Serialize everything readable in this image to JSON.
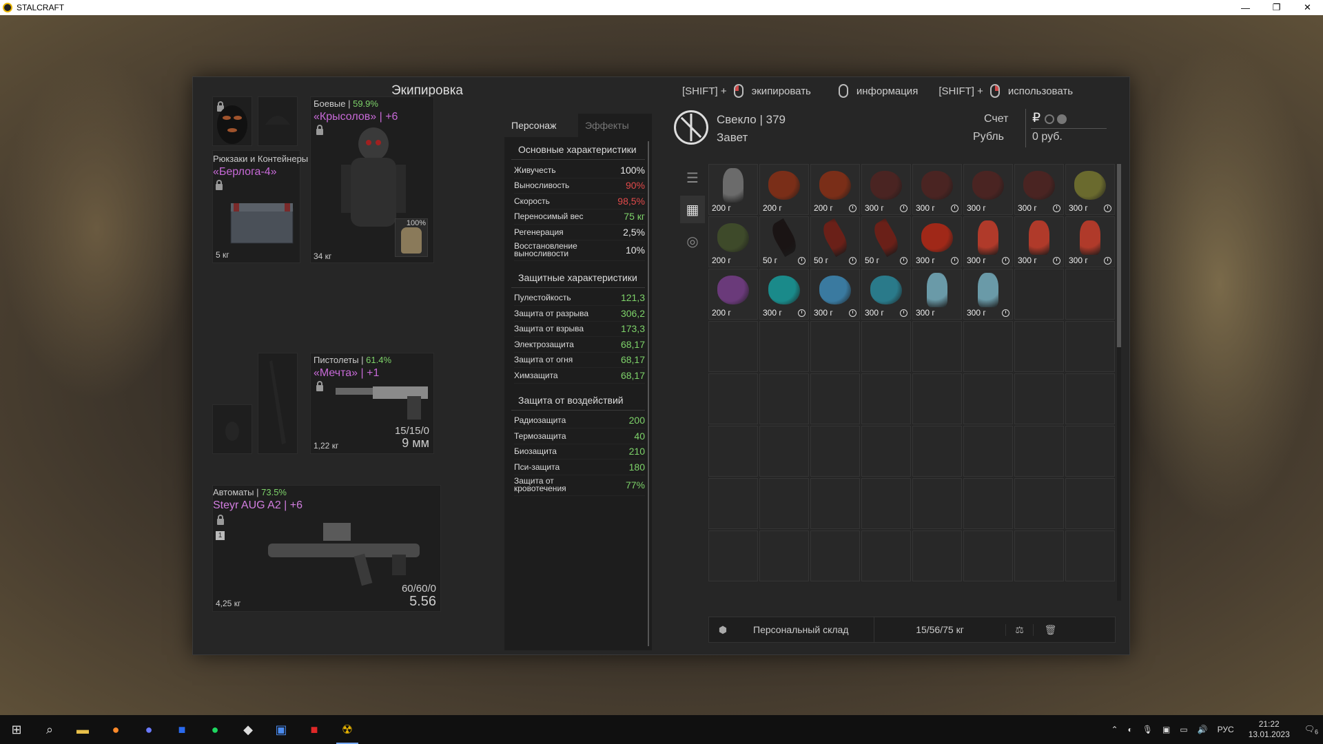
{
  "window_title": "STALCRAFT",
  "window_controls": {
    "minimize": "—",
    "restore": "❐",
    "close": "✕"
  },
  "left_header": "Экипировка",
  "hints": [
    {
      "prefix": "[SHIFT] +",
      "label": "экипировать"
    },
    {
      "prefix": "",
      "label": "информация"
    },
    {
      "prefix": "[SHIFT] +",
      "label": "использовать"
    }
  ],
  "backpack": {
    "title": "Рюкзаки и Контейнеры",
    "name": "«Берлога-4»",
    "weight": "5 кг"
  },
  "armor": {
    "category": "Боевые",
    "percent": "59.9%",
    "name": "«Крысолов»",
    "upgrade": "+6",
    "weight": "34 кг",
    "durability": "100%"
  },
  "pistol": {
    "category": "Пистолеты",
    "percent": "61.4%",
    "name": "«Мечта»",
    "upgrade": "+1",
    "weight": "1,22 кг",
    "ammo": "15/15/0",
    "caliber": "9 мм"
  },
  "rifle": {
    "category": "Автоматы",
    "percent": "73.5%",
    "name": "Steyr AUG A2",
    "upgrade": "+6",
    "weight": "4,25 кг",
    "ammo": "60/60/0",
    "caliber": "5.56",
    "slot_number": "1"
  },
  "stats_tabs": [
    "Персонаж",
    "Эффекты"
  ],
  "sections": [
    {
      "title": "Основные характеристики",
      "rows": [
        {
          "label": "Живучесть",
          "value": "100%",
          "color": "white"
        },
        {
          "label": "Выносливость",
          "value": "90%",
          "color": "red"
        },
        {
          "label": "Скорость",
          "value": "98,5%",
          "color": "red"
        },
        {
          "label": "Переносимый вес",
          "value": "75 кг",
          "color": "green"
        },
        {
          "label": "Регенерация",
          "value": "2,5%",
          "color": "white"
        },
        {
          "label": "Восстановление выносливости",
          "value": "10%",
          "color": "white",
          "tall": true
        }
      ]
    },
    {
      "title": "Защитные характеристики",
      "rows": [
        {
          "label": "Пулестойкость",
          "value": "121,3",
          "color": "green"
        },
        {
          "label": "Защита от разрыва",
          "value": "306,2",
          "color": "green"
        },
        {
          "label": "Защита от взрыва",
          "value": "173,3",
          "color": "green"
        },
        {
          "label": "Электрозащита",
          "value": "68,17",
          "color": "green"
        },
        {
          "label": "Защита от огня",
          "value": "68,17",
          "color": "green"
        },
        {
          "label": "Химзащита",
          "value": "68,17",
          "color": "green"
        }
      ]
    },
    {
      "title": "Защита от воздействий",
      "rows": [
        {
          "label": "Радиозащита",
          "value": "200",
          "color": "green"
        },
        {
          "label": "Термозащита",
          "value": "40",
          "color": "green"
        },
        {
          "label": "Биозащита",
          "value": "210",
          "color": "green"
        },
        {
          "label": "Пси-защита",
          "value": "180",
          "color": "green"
        },
        {
          "label": "Защита от кровотечения",
          "value": "77%",
          "color": "green",
          "tall": true
        }
      ]
    }
  ],
  "profile": {
    "name": "Свекло",
    "level": "379",
    "faction": "Завет",
    "account_label": "Счет",
    "currency_label": "Рубль",
    "balance": "0 руб.",
    "currency_symbol": "₽"
  },
  "inventory": [
    {
      "weight": "200 г",
      "timer": false,
      "color": "#6b6b6b",
      "shape": "crystal"
    },
    {
      "weight": "200 г",
      "timer": false,
      "color": "#7a2e18",
      "shape": "blob"
    },
    {
      "weight": "200 г",
      "timer": true,
      "color": "#7a2e18",
      "shape": "blob"
    },
    {
      "weight": "300 г",
      "timer": true,
      "color": "#4a2422",
      "shape": "blob"
    },
    {
      "weight": "300 г",
      "timer": true,
      "color": "#4a2422",
      "shape": "blob"
    },
    {
      "weight": "300 г",
      "timer": false,
      "color": "#4a2422",
      "shape": "blob"
    },
    {
      "weight": "300 г",
      "timer": true,
      "color": "#4a2422",
      "shape": "blob"
    },
    {
      "weight": "300 г",
      "timer": true,
      "color": "#6a6a2e",
      "shape": "blob"
    },
    {
      "weight": "200 г",
      "timer": false,
      "color": "#3e4a2a",
      "shape": "blob"
    },
    {
      "weight": "50 г",
      "timer": true,
      "color": "#1a1414",
      "shape": "leaf"
    },
    {
      "weight": "50 г",
      "timer": true,
      "color": "#6a2018",
      "shape": "leaf"
    },
    {
      "weight": "50 г",
      "timer": true,
      "color": "#6a2018",
      "shape": "leaf"
    },
    {
      "weight": "300 г",
      "timer": true,
      "color": "#a02818",
      "shape": "blob"
    },
    {
      "weight": "300 г",
      "timer": true,
      "color": "#b03a2a",
      "shape": "crystal"
    },
    {
      "weight": "300 г",
      "timer": true,
      "color": "#b03a2a",
      "shape": "crystal"
    },
    {
      "weight": "300 г",
      "timer": true,
      "color": "#b03a2a",
      "shape": "crystal"
    },
    {
      "weight": "200 г",
      "timer": false,
      "color": "#6a3a7a",
      "shape": "blob"
    },
    {
      "weight": "300 г",
      "timer": true,
      "color": "#1a8a8a",
      "shape": "blob"
    },
    {
      "weight": "300 г",
      "timer": true,
      "color": "#3a7aa0",
      "shape": "blob"
    },
    {
      "weight": "300 г",
      "timer": true,
      "color": "#2a7a8a",
      "shape": "blob"
    },
    {
      "weight": "300 г",
      "timer": false,
      "color": "#6a9aa8",
      "shape": "crystal"
    },
    {
      "weight": "300 г",
      "timer": true,
      "color": "#6a9aa8",
      "shape": "crystal"
    }
  ],
  "inventory_total_cells": 64,
  "storage": {
    "label": "Персональный склад",
    "weight": "15/56/75 кг"
  },
  "taskbar": {
    "lang": "РУС",
    "time": "21:22",
    "date": "13.01.2023",
    "notifications": "6"
  }
}
